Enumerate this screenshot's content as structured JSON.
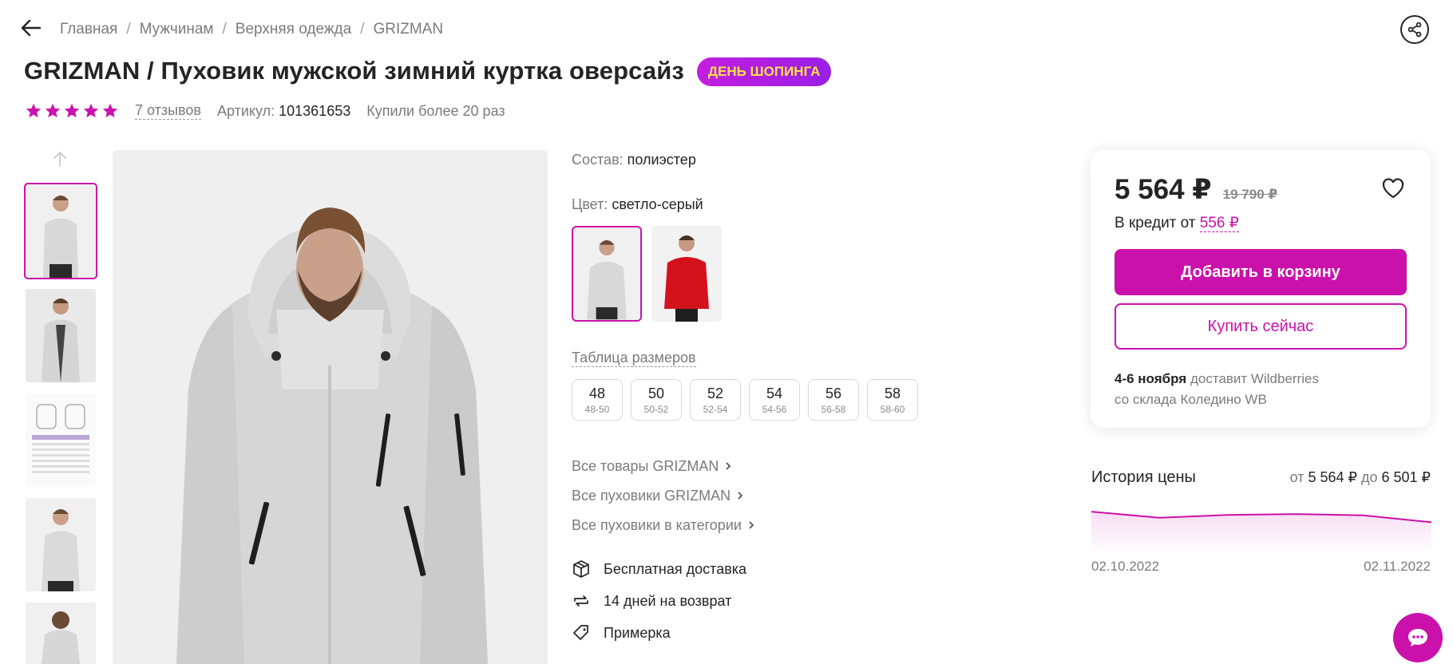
{
  "breadcrumbs": [
    "Главная",
    "Мужчинам",
    "Верхняя одежда",
    "GRIZMAN"
  ],
  "breadcrumb_separator": "/",
  "product": {
    "title": "GRIZMAN / Пуховик мужской зимний куртка оверсайз",
    "promo_badge": "ДЕНЬ ШОПИНГА",
    "rating_stars": 5,
    "reviews": "7 отзывов",
    "article_label": "Артикул:",
    "article_value": "101361653",
    "bought": "Купили более 20 раз"
  },
  "params": {
    "composition_label": "Состав:",
    "composition_value": "полиэстер",
    "color_label": "Цвет:",
    "color_value": "светло-серый",
    "colors": [
      {
        "name": "светло-серый",
        "swatch": "#d9d9d9",
        "active": true
      },
      {
        "name": "красный",
        "swatch": "#d4121c",
        "active": false
      }
    ],
    "size_table_link": "Таблица размеров",
    "sizes": [
      {
        "size": "48",
        "range": "48-50"
      },
      {
        "size": "50",
        "range": "50-52"
      },
      {
        "size": "52",
        "range": "52-54"
      },
      {
        "size": "54",
        "range": "54-56"
      },
      {
        "size": "56",
        "range": "56-58"
      },
      {
        "size": "58",
        "range": "58-60"
      }
    ]
  },
  "links": [
    "Все товары GRIZMAN",
    "Все пуховики GRIZMAN",
    "Все пуховики в категории"
  ],
  "features": [
    {
      "icon": "box-icon",
      "label": "Бесплатная доставка"
    },
    {
      "icon": "return-arrows-icon",
      "label": "14 дней на возврат"
    },
    {
      "icon": "tag-icon",
      "label": "Примерка"
    }
  ],
  "price_card": {
    "price": "5 564 ₽",
    "old_price": "19 790 ₽",
    "credit_label": "В кредит от",
    "credit_value": "556 ₽",
    "add_to_cart": "Добавить в корзину",
    "buy_now": "Купить сейчас",
    "delivery_date": "4-6 ноября",
    "delivery_by": "доставит Wildberries",
    "delivery_from": "со склада Коледино WB"
  },
  "price_history": {
    "title": "История цены",
    "range_from_label": "от",
    "range_from": "5 564 ₽",
    "range_to_label": "до",
    "range_to": "6 501 ₽",
    "date_start": "02.10.2022",
    "date_end": "02.11.2022"
  },
  "colors": {
    "accent": "#cb11ab",
    "badge_text": "#ffe14d",
    "text": "#242424",
    "muted": "#7b7b7b"
  },
  "chart_data": {
    "type": "line",
    "x": [
      "02.10.2022",
      "02.11.2022"
    ],
    "series": [
      {
        "values": [
          6480,
          6330,
          6400,
          6420,
          6390,
          6220
        ]
      }
    ],
    "ylim": [
      5564,
      6501
    ],
    "grid": false
  }
}
